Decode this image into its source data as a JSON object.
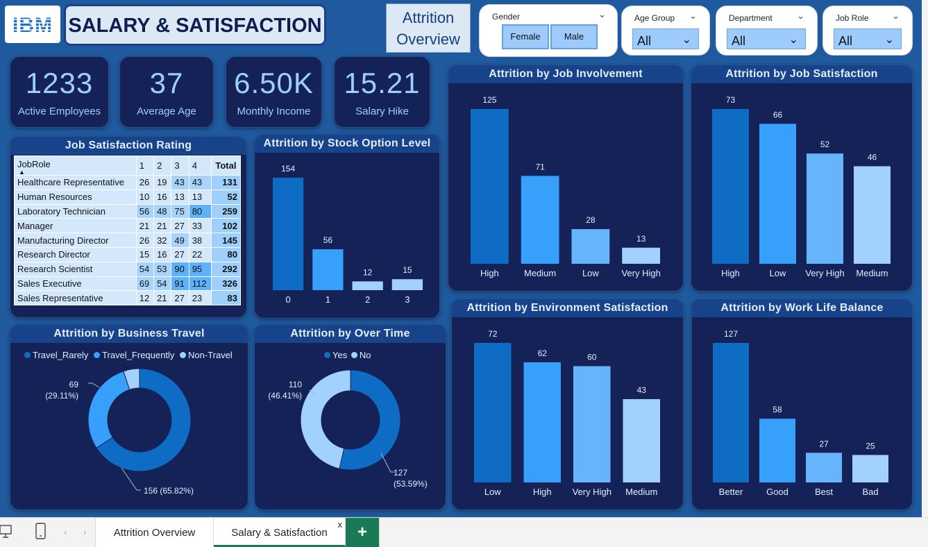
{
  "header": {
    "logo": "IBM",
    "title": "SALARY & SATISFACTION",
    "nav_button": "Attrition Overview"
  },
  "filters": {
    "gender": {
      "title": "Gender",
      "options": [
        "Female",
        "Male"
      ]
    },
    "age_group": {
      "title": "Age Group",
      "value": "All"
    },
    "department": {
      "title": "Department",
      "value": "All"
    },
    "job_role": {
      "title": "Job Role",
      "value": "All"
    }
  },
  "kpis": [
    {
      "value": "1233",
      "label": "Active Employees"
    },
    {
      "value": "37",
      "label": "Average Age"
    },
    {
      "value": "6.50K",
      "label": "Monthly Income"
    },
    {
      "value": "15.21",
      "label": "Salary Hike"
    }
  ],
  "job_satisfaction": {
    "title": "Job Satisfaction Rating",
    "headers": [
      "JobRole",
      "1",
      "2",
      "3",
      "4",
      "Total"
    ],
    "rows": [
      {
        "role": "Healthcare Representative",
        "v": [
          26,
          19,
          43,
          43
        ],
        "total": 131
      },
      {
        "role": "Human Resources",
        "v": [
          10,
          16,
          13,
          13
        ],
        "total": 52
      },
      {
        "role": "Laboratory Technician",
        "v": [
          56,
          48,
          75,
          80
        ],
        "total": 259
      },
      {
        "role": "Manager",
        "v": [
          21,
          21,
          27,
          33
        ],
        "total": 102
      },
      {
        "role": "Manufacturing Director",
        "v": [
          26,
          32,
          49,
          38
        ],
        "total": 145
      },
      {
        "role": "Research Director",
        "v": [
          15,
          16,
          27,
          22
        ],
        "total": 80
      },
      {
        "role": "Research Scientist",
        "v": [
          54,
          53,
          90,
          95
        ],
        "total": 292
      },
      {
        "role": "Sales Executive",
        "v": [
          69,
          54,
          91,
          112
        ],
        "total": 326
      },
      {
        "role": "Sales Representative",
        "v": [
          12,
          21,
          27,
          23
        ],
        "total": 83
      }
    ]
  },
  "colors": {
    "dark_blue": "#0f6cc4",
    "mid_blue": "#37a0fb",
    "light_blue": "#66b5fc",
    "pale_blue": "#a3d1fd",
    "panel": "#142258",
    "canvas": "#1f5a9e"
  },
  "chart_data": [
    {
      "id": "stock",
      "type": "bar",
      "title": "Attrition by Stock Option Level",
      "categories": [
        "0",
        "1",
        "2",
        "3"
      ],
      "values": [
        154,
        56,
        12,
        15
      ],
      "colors": [
        "#0f6cc4",
        "#37a0fb",
        "#a3d1fd",
        "#a3d1fd"
      ]
    },
    {
      "id": "involvement",
      "type": "bar",
      "title": "Attrition by Job Involvement",
      "categories": [
        "High",
        "Medium",
        "Low",
        "Very High"
      ],
      "values": [
        125,
        71,
        28,
        13
      ],
      "colors": [
        "#0f6cc4",
        "#37a0fb",
        "#66b5fc",
        "#a3d1fd"
      ]
    },
    {
      "id": "satisfaction",
      "type": "bar",
      "title": "Attrition by Job Satisfaction",
      "categories": [
        "High",
        "Low",
        "Very High",
        "Medium"
      ],
      "values": [
        73,
        66,
        52,
        46
      ],
      "colors": [
        "#0f6cc4",
        "#37a0fb",
        "#66b5fc",
        "#a3d1fd"
      ]
    },
    {
      "id": "environment",
      "type": "bar",
      "title": "Attrition by Environment Satisfaction",
      "categories": [
        "Low",
        "High",
        "Very High",
        "Medium"
      ],
      "values": [
        72,
        62,
        60,
        43
      ],
      "colors": [
        "#0f6cc4",
        "#37a0fb",
        "#66b5fc",
        "#a3d1fd"
      ]
    },
    {
      "id": "worklife",
      "type": "bar",
      "title": "Attrition by Work Life Balance",
      "categories": [
        "Better",
        "Good",
        "Best",
        "Bad"
      ],
      "values": [
        127,
        58,
        27,
        25
      ],
      "colors": [
        "#0f6cc4",
        "#37a0fb",
        "#66b5fc",
        "#a3d1fd"
      ]
    },
    {
      "id": "travel",
      "type": "pie",
      "title": "Attrition by Business Travel",
      "legend": [
        "Travel_Rarely",
        "Travel_Frequently",
        "Non-Travel"
      ],
      "values": [
        156,
        69,
        12
      ],
      "colors": [
        "#0f6cc4",
        "#37a0fb",
        "#a3d1fd"
      ],
      "labels": [
        "156 (65.82%)",
        "69 (29.11%)",
        ""
      ]
    },
    {
      "id": "overtime",
      "type": "pie",
      "title": "Attrition by Over Time",
      "legend": [
        "Yes",
        "No"
      ],
      "values": [
        127,
        110
      ],
      "colors": [
        "#0f6cc4",
        "#a3d1fd"
      ],
      "labels": [
        "127 (53.59%)",
        "110 (46.41%)"
      ]
    }
  ],
  "tabs": {
    "tab1": "Attrition Overview",
    "tab2": "Salary & Satisfaction",
    "close": "x",
    "add": "+"
  }
}
